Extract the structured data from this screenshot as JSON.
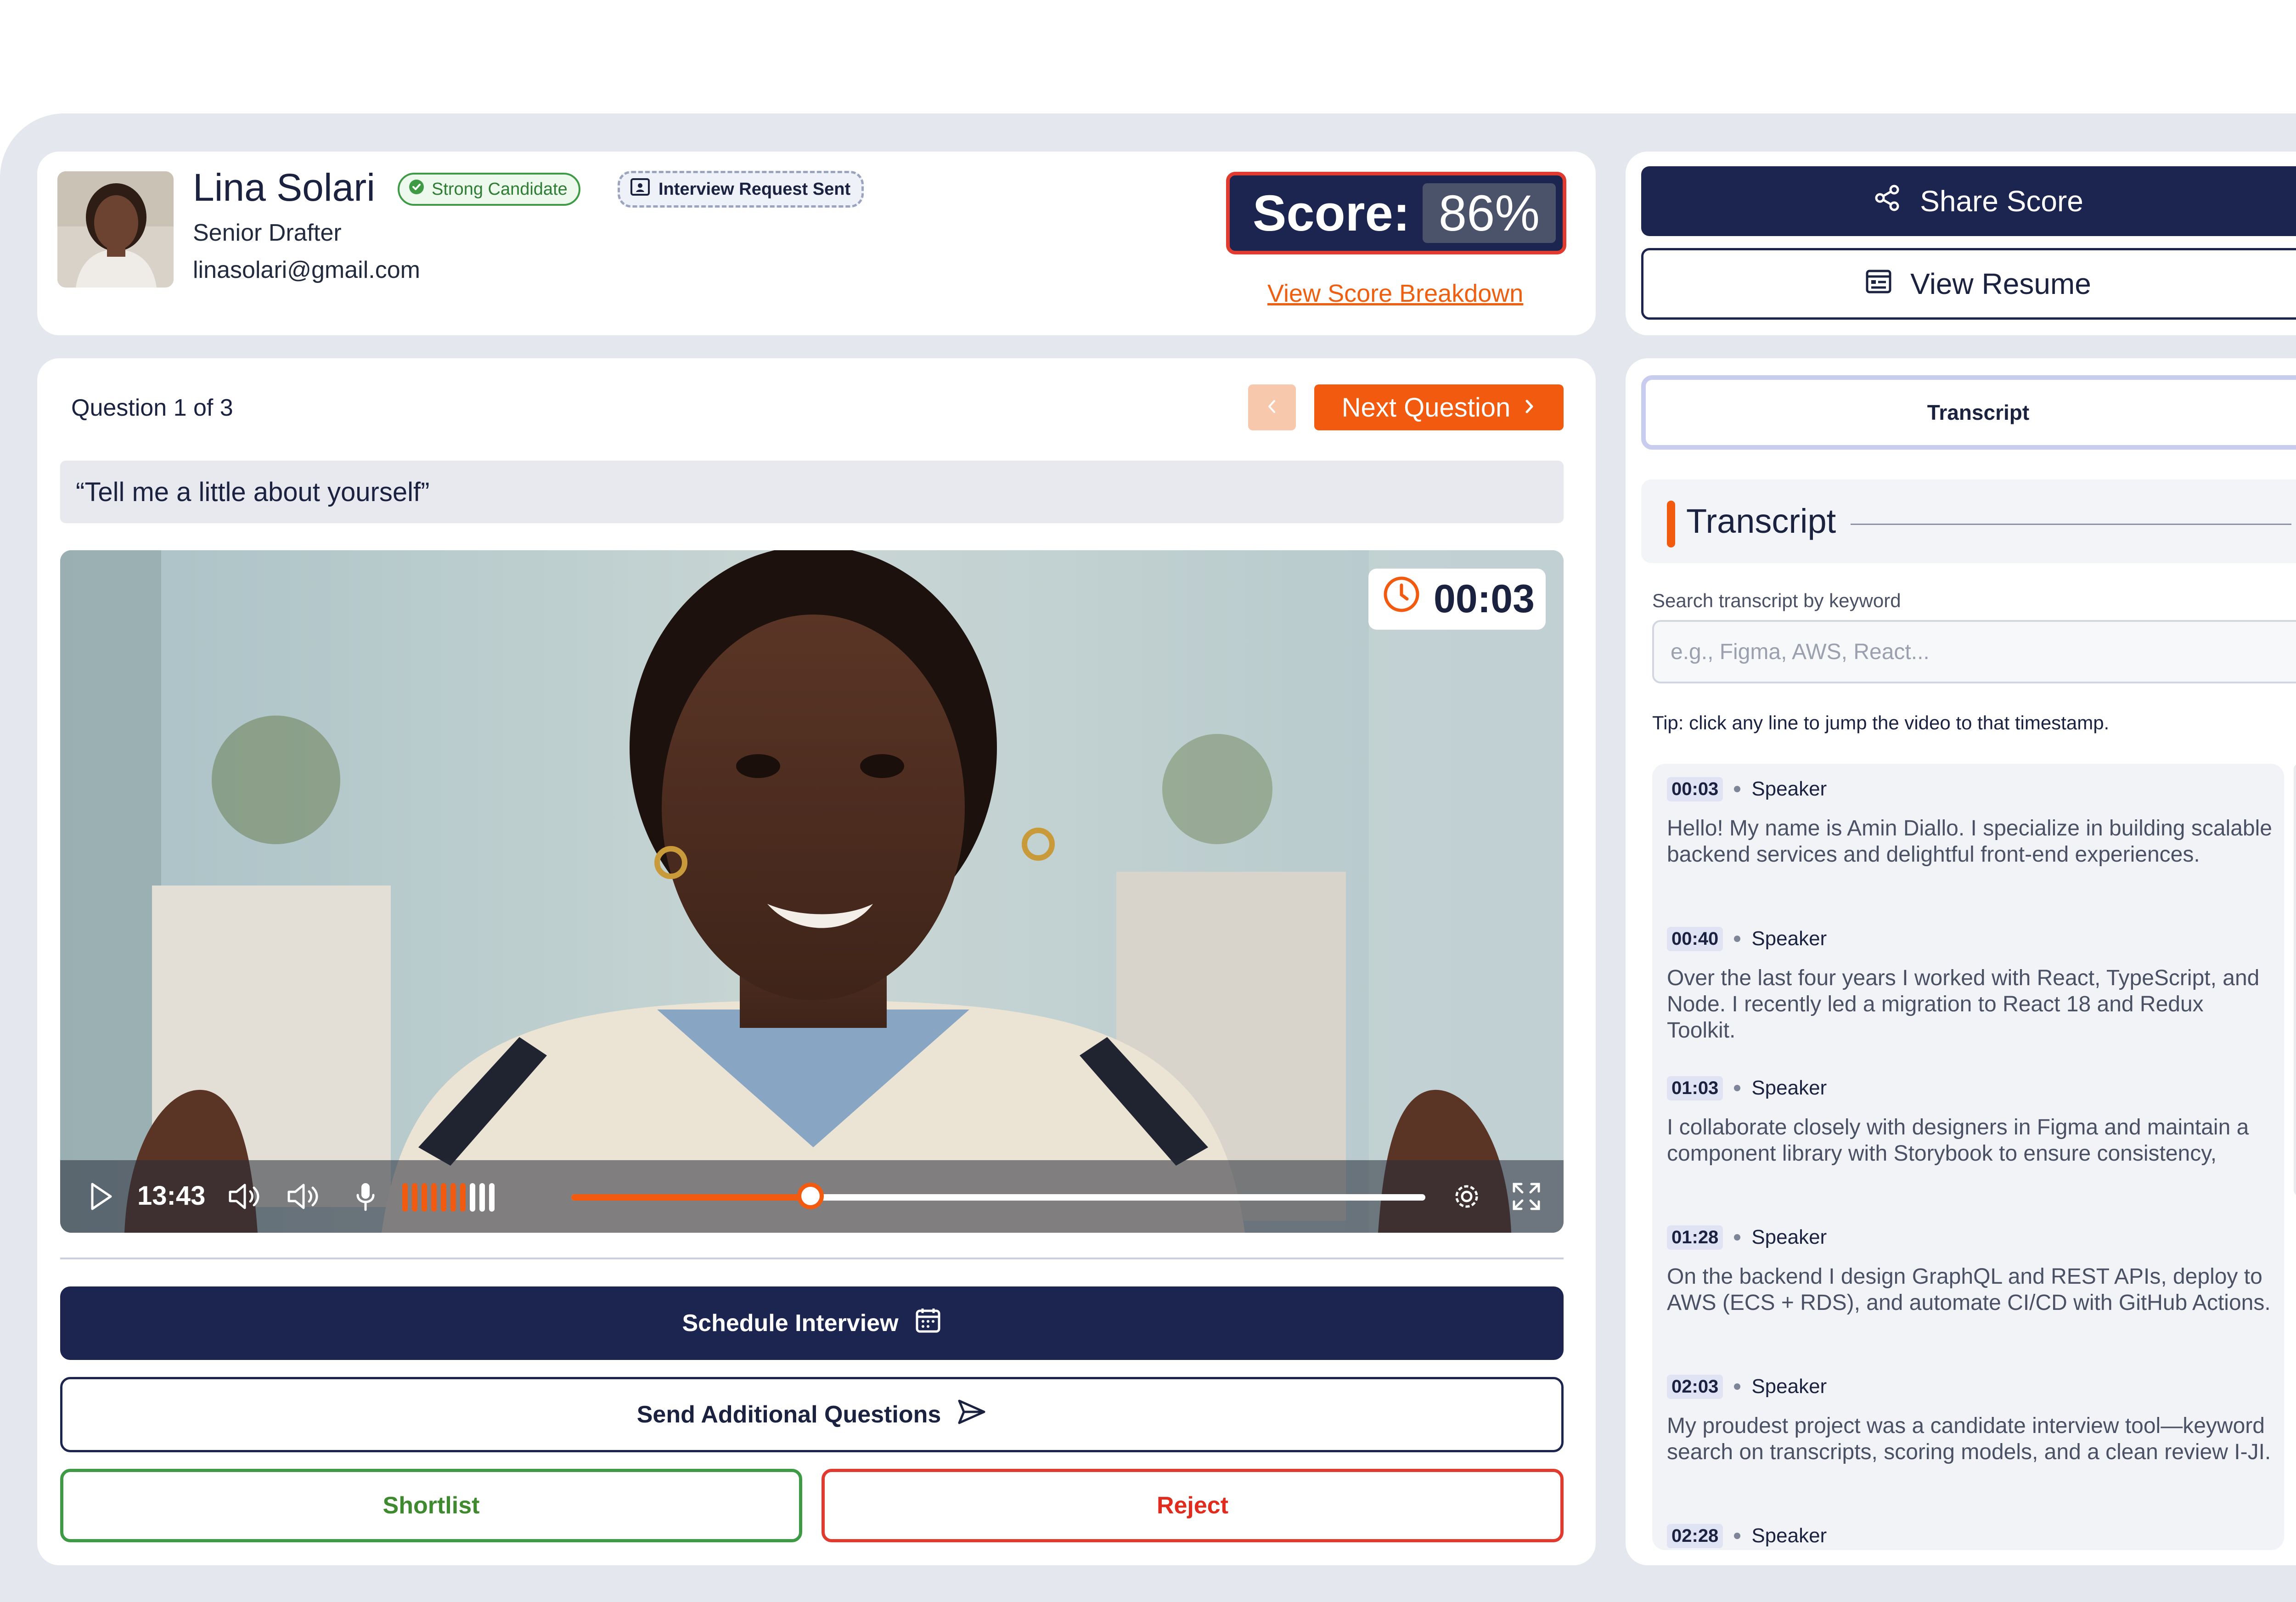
{
  "candidate": {
    "name": "Lina Solari",
    "role": "Senior Drafter",
    "email": "linasolari@gmail.com",
    "badge_status": "Strong Candidate",
    "badge_interview": "Interview Request Sent",
    "score_label": "Score:",
    "score_value": "86%",
    "score_breakdown_link": "View Score Breakdown"
  },
  "actions_top": {
    "share": "Share Score",
    "resume": "View Resume"
  },
  "question": {
    "counter": "Question 1 of 3",
    "next_label": "Next Question",
    "prompt": "“Tell me a little about yourself”"
  },
  "video": {
    "timer": "00:03",
    "elapsed": "13:43",
    "progress": 0.28,
    "mic_level": 0.7
  },
  "actions_bottom": {
    "schedule": "Schedule Interview",
    "send": "Send Additional Questions",
    "shortlist": "Shortlist",
    "reject": "Reject"
  },
  "transcript": {
    "tab_label": "Transcript",
    "title": "Transcript",
    "search_label": "Search transcript by keyword",
    "search_placeholder": "e.g., Figma, AWS, React...",
    "tip": "Tip: click any line to jump the video to that timestamp.",
    "entries": [
      {
        "time": "00:03",
        "speaker": "Speaker",
        "text": "Hello! My name is Amin Diallo. I specialize  in building scalable backend services and  delightful front-end experiences."
      },
      {
        "time": "00:40",
        "speaker": "Speaker",
        "text": "Over the last four years I worked with  React, TypeScript, and Node. I recently led  a migration to React 18 and Redux Toolkit."
      },
      {
        "time": "01:03",
        "speaker": "Speaker",
        "text": "I collaborate closely with designers in  Figma and maintain a component library  with Storybook to ensure consistency,"
      },
      {
        "time": "01:28",
        "speaker": "Speaker",
        "text": "On the backend I design GraphQL and  REST APIs, deploy to AWS (ECS + RDS),  and automate CI/CD with GitHub Actions."
      },
      {
        "time": "02:03",
        "speaker": "Speaker",
        "text": "My proudest project was a candidate  interview tool—keyword search on  transcripts, scoring models, and a clean  review I-JI."
      },
      {
        "time": "02:28",
        "speaker": "Speaker",
        "text": ""
      }
    ]
  },
  "colors": {
    "navy": "#1b2550",
    "orange": "#f15a0f",
    "green": "#3f9a46",
    "red": "#e03b2e"
  }
}
